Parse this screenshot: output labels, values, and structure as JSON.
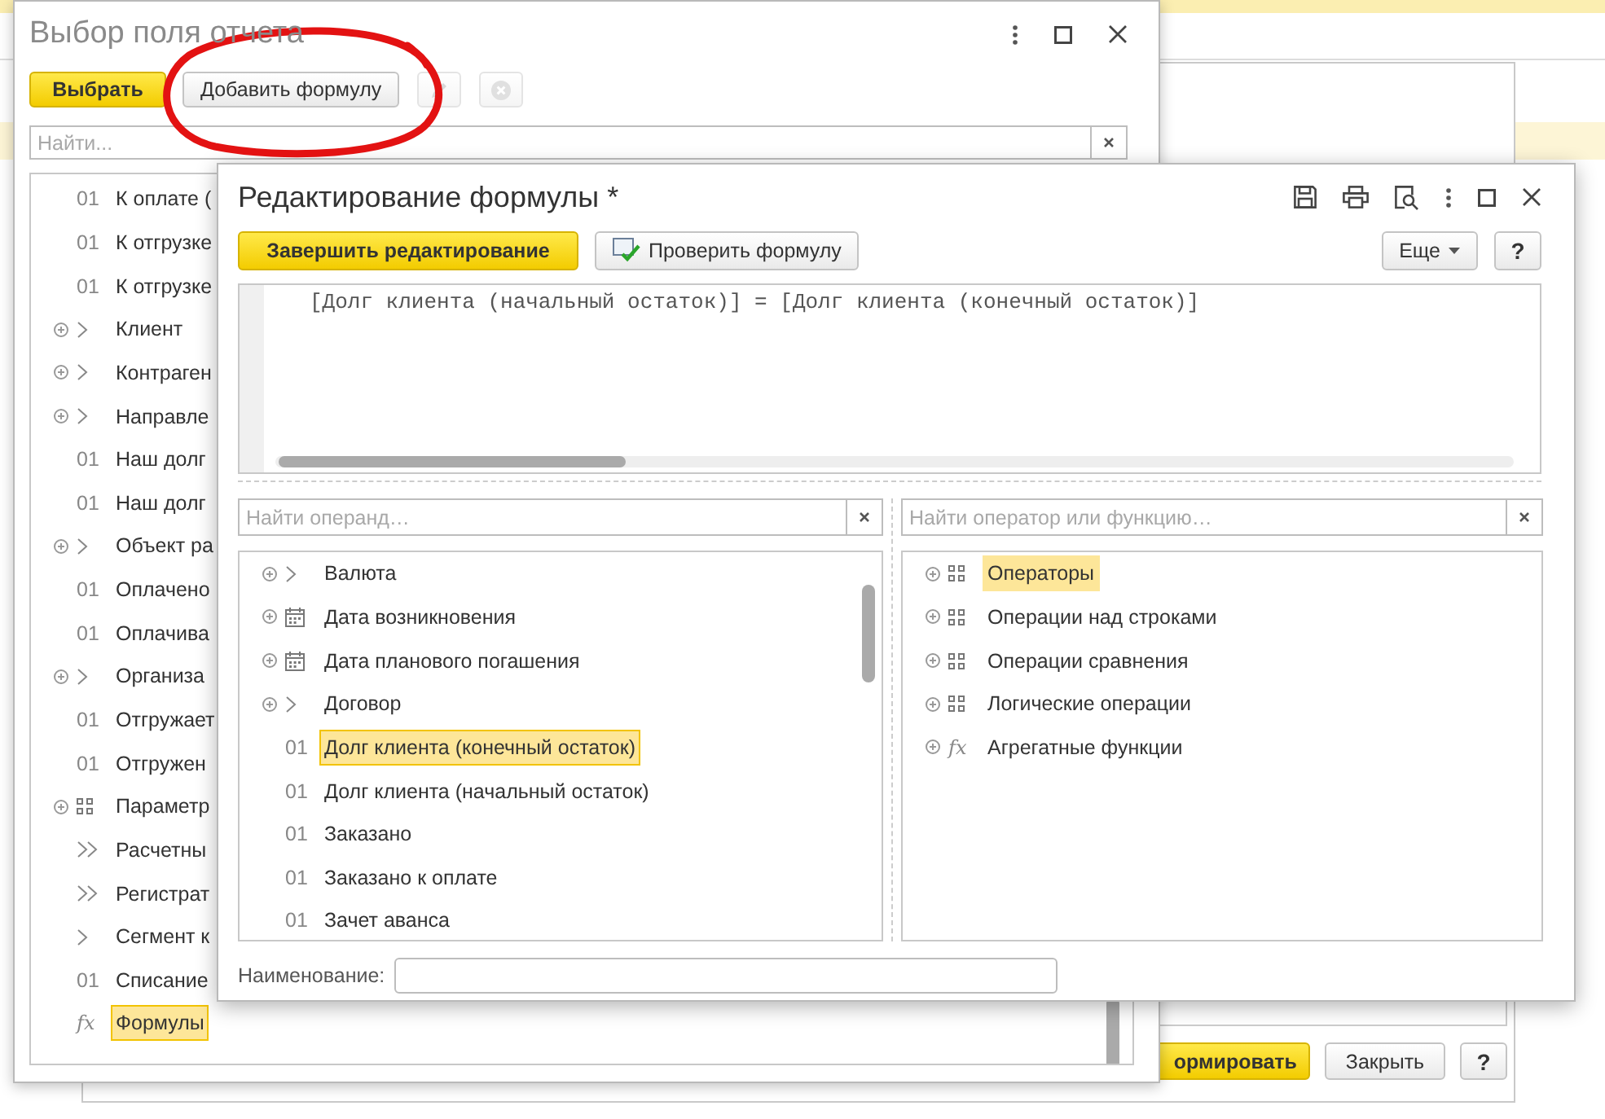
{
  "report_window": {
    "buttons": [
      {
        "label": "ормировать",
        "kind": "primary"
      },
      {
        "label": "Закрыть",
        "kind": "default"
      },
      {
        "label": "?",
        "kind": "help"
      }
    ]
  },
  "field_picker": {
    "title": "Выбор поля отчета",
    "toolbar": [
      {
        "label": "Выбрать",
        "kind": "primary"
      },
      {
        "label": "Добавить формулу",
        "kind": "default"
      },
      {
        "kind": "edit",
        "disabled": true
      },
      {
        "kind": "delete",
        "disabled": true
      }
    ],
    "search": {
      "placeholder": "Найти..."
    },
    "focused": true,
    "fields": [
      {
        "kind": "field",
        "prefix": "01",
        "label": "К оплате (",
        "selected": false
      },
      {
        "kind": "field",
        "prefix": "01",
        "label": "К отгрузке",
        "selected": false
      },
      {
        "kind": "field",
        "prefix": "01",
        "label": "К отгрузке",
        "selected": false
      },
      {
        "kind": "object",
        "label": "Клиент",
        "selected": false
      },
      {
        "kind": "object",
        "label": "Контраген",
        "selected": false
      },
      {
        "kind": "object",
        "label": "Направле",
        "selected": false
      },
      {
        "kind": "field",
        "prefix": "01",
        "label": "Наш долг",
        "selected": false
      },
      {
        "kind": "field",
        "prefix": "01",
        "label": "Наш долг",
        "selected": false
      },
      {
        "kind": "object",
        "label": "Объект ра",
        "selected": false
      },
      {
        "kind": "field",
        "prefix": "01",
        "label": "Оплачено",
        "selected": false
      },
      {
        "kind": "field",
        "prefix": "01",
        "label": "Оплачива",
        "selected": false
      },
      {
        "kind": "object",
        "label": "Организа",
        "selected": false
      },
      {
        "kind": "field",
        "prefix": "01",
        "label": "Отгружает",
        "selected": false
      },
      {
        "kind": "field",
        "prefix": "01",
        "label": "Отгружен",
        "selected": false
      },
      {
        "kind": "params",
        "label": "Параметр",
        "selected": false
      },
      {
        "kind": "table",
        "label": "Расчетны",
        "selected": false
      },
      {
        "kind": "table",
        "label": "Регистрат",
        "selected": false
      },
      {
        "kind": "ref",
        "label": "Сегмент к",
        "selected": false
      },
      {
        "kind": "field",
        "prefix": "01",
        "label": "Списание",
        "selected": false
      },
      {
        "kind": "formula",
        "prefix": "fx",
        "label": "Формулы",
        "selected": true
      }
    ]
  },
  "formula_editor": {
    "title": "Редактирование формулы *",
    "toolbar": [
      {
        "label": "Завершить редактирование",
        "kind": "primary"
      },
      {
        "label": "Проверить формулу",
        "kind": "check"
      },
      {
        "label": "Еще",
        "kind": "menu"
      },
      {
        "label": "?",
        "kind": "help"
      }
    ],
    "formula": "[Долг клиента (начальный остаток)] = [Долг клиента (конечный остаток)]",
    "operand_search": {
      "placeholder": "Найти операнд…"
    },
    "operator_search": {
      "placeholder": "Найти оператор или функцию…"
    },
    "operands_focused": true,
    "operands": [
      {
        "kind": "object",
        "label": "Валюта",
        "selected": false
      },
      {
        "kind": "date",
        "label": "Дата возникновения",
        "selected": false
      },
      {
        "kind": "date",
        "label": "Дата планового погашения",
        "selected": false
      },
      {
        "kind": "object",
        "label": "Договор",
        "selected": false
      },
      {
        "kind": "field",
        "prefix": "01",
        "label": "Долг клиента (конечный остаток)",
        "selected": true
      },
      {
        "kind": "field",
        "prefix": "01",
        "label": "Долг клиента (начальный остаток)",
        "selected": false
      },
      {
        "kind": "field",
        "prefix": "01",
        "label": "Заказано",
        "selected": false
      },
      {
        "kind": "field",
        "prefix": "01",
        "label": "Заказано к оплате",
        "selected": false
      },
      {
        "kind": "field",
        "prefix": "01",
        "label": "Зачет аванса",
        "selected": false
      }
    ],
    "operators_focused": false,
    "operators": [
      {
        "kind": "params",
        "label": "Операторы",
        "selected": true
      },
      {
        "kind": "params",
        "label": "Операции над строками",
        "selected": false
      },
      {
        "kind": "params",
        "label": "Операции сравнения",
        "selected": false
      },
      {
        "kind": "params",
        "label": "Логические операции",
        "selected": false
      },
      {
        "kind": "function_group",
        "prefix": "fx",
        "label": "Агрегатные функции",
        "selected": false
      }
    ],
    "name_label": "Наименование:"
  }
}
